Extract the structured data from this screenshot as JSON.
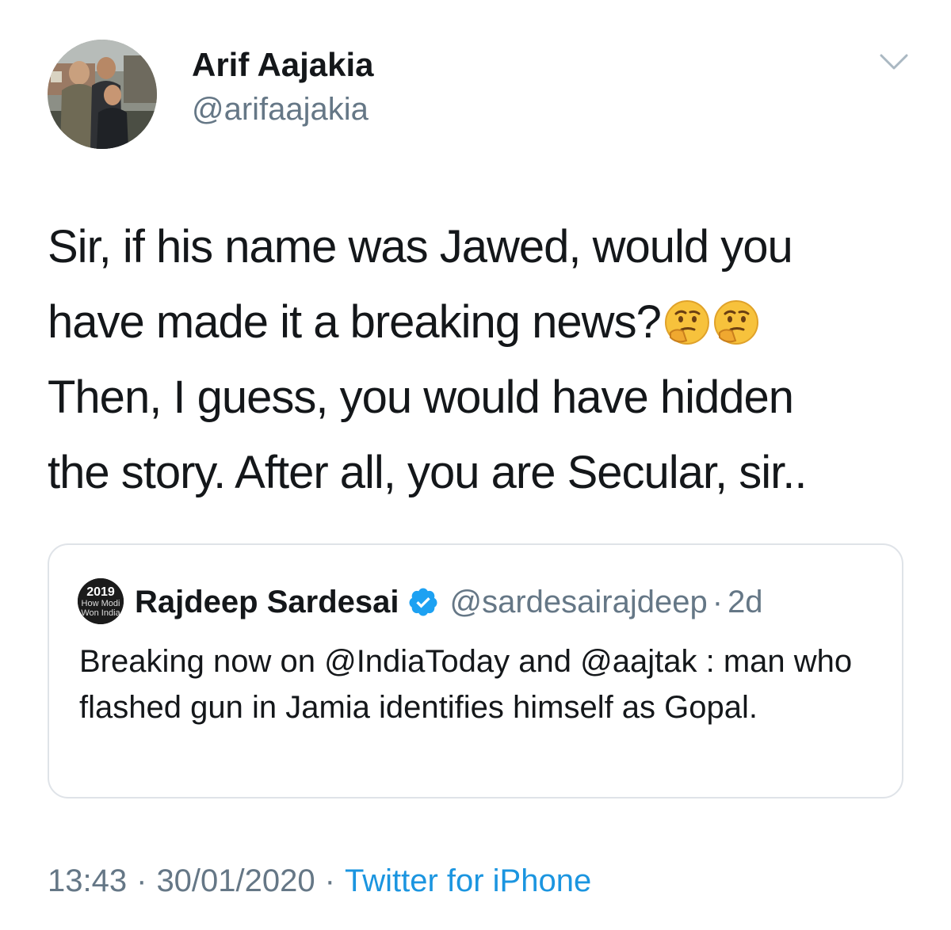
{
  "tweet": {
    "author_name": "Arif Aajakia",
    "author_handle": "@arifaajakia",
    "text_lines": [
      "Sir, if his name was Jawed, would you",
      "have made it a breaking news?",
      "Then, I guess, you would have hidden",
      "the story. After all, you are Secular, sir.."
    ],
    "emoji_icons": [
      "thinking-face-icon",
      "thinking-face-icon"
    ],
    "menu_icon": "chevron-down-icon"
  },
  "quoted_tweet": {
    "author_name": "Rajdeep Sardesai",
    "verified_icon": "verified-badge-icon",
    "author_handle": "@sardesairajdeep",
    "separator": "·",
    "time": "2d",
    "avatar_text": [
      "2019",
      "How Modi",
      "Won India"
    ],
    "text": "Breaking now on @IndiaToday and @aajtak : man who flashed gun in Jamia identifies himself as Gopal."
  },
  "footer": {
    "time": "13:43",
    "separator": "·",
    "date": "30/01/2020",
    "source": "Twitter for iPhone"
  },
  "colors": {
    "text_primary": "#14171a",
    "text_secondary": "#657786",
    "link": "#1b95e0",
    "verified": "#1da1f2",
    "card_border": "#dfe3e8"
  }
}
